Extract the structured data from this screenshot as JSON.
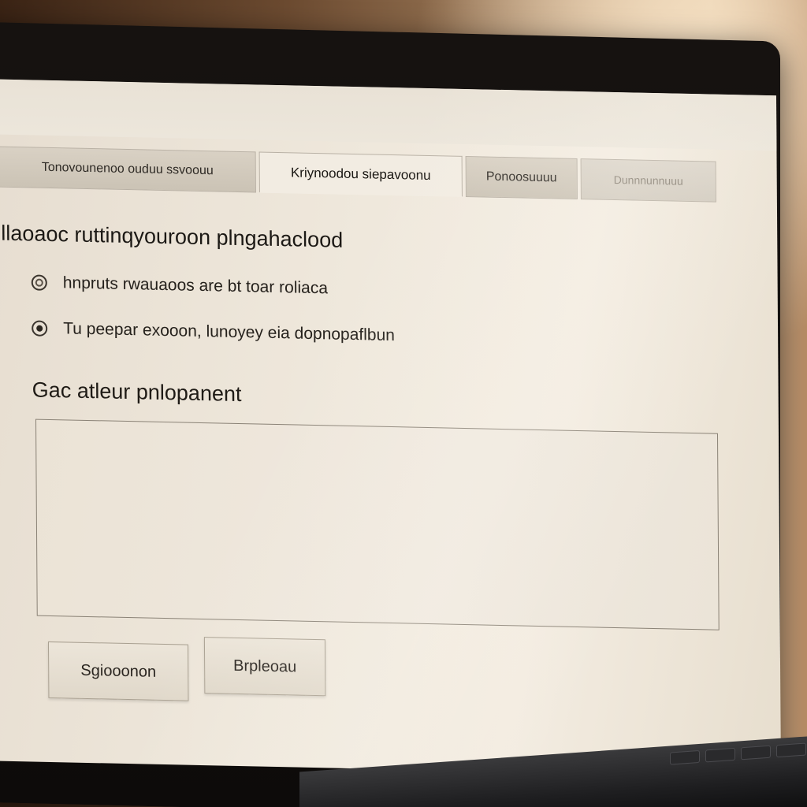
{
  "tabs": [
    {
      "label": "Tonovounenoo ouduu ssvoouu",
      "state": "inactive"
    },
    {
      "label": "Kriynoodou siepavoonu",
      "state": "active"
    },
    {
      "label": "Ponoosuuuu",
      "state": "inactive"
    },
    {
      "label": "Dunnnunnuuu",
      "state": "faded"
    }
  ],
  "form": {
    "title": "llaoaoc ruttinqyouroon plngahaclood",
    "options": [
      {
        "label": "hnpruts rwauaoos are bt toar roliaca",
        "selected": false
      },
      {
        "label": "Tu peepar exooon, lunoyey eia dopnopaflbun",
        "selected": true
      }
    ],
    "field_label": "Gac atleur pnlopanent",
    "textarea_value": ""
  },
  "buttons": {
    "primary_label": "Sgiooonon",
    "secondary_label": "Brpleoau"
  },
  "colors": {
    "screen_bg": "#efe8dc",
    "bezel": "#0d0b0a",
    "text": "#1c1915"
  }
}
